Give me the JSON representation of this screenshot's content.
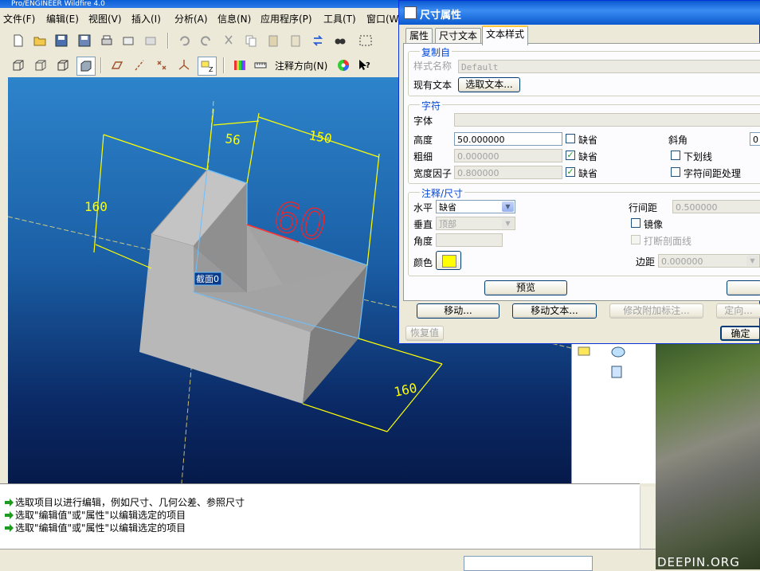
{
  "app": {
    "title": "Pro/ENGINEER Wildfire 4.0",
    "menu": [
      "文件(F)",
      "编辑(E)",
      "视图(V)",
      "插入(I)",
      "分析(A)",
      "信息(N)",
      "应用程序(P)",
      "工具(T)",
      "窗口(W)"
    ],
    "toolbar_annotation_dir": "注释方向(N)"
  },
  "model": {
    "dim_56": "56",
    "dim_150": "150",
    "dim_160_left": "160",
    "dim_160_bottom": "160",
    "dim_60": "60",
    "section_label": "截面0"
  },
  "messages": [
    "选取项目以进行编辑，例如尺寸、几何公差、参照尺寸",
    "选取\"编辑值\"或\"属性\"以编辑选定的项目",
    "选取\"编辑值\"或\"属性\"以编辑选定的项目"
  ],
  "dialog": {
    "title": "尺寸属性",
    "tabs": [
      "属性",
      "尺寸文本",
      "文本样式"
    ],
    "copy_group": {
      "title": "复制自",
      "style_name_label": "样式名称",
      "style_name_value": "Default",
      "existing_text_label": "现有文本",
      "select_text_button": "选取文本..."
    },
    "char_group": {
      "title": "字符",
      "font_label": "字体",
      "font_value": "",
      "height_label": "高度",
      "height_value": "50.000000",
      "default_label": "缺省",
      "slant_label": "斜角",
      "slant_value": "0",
      "thickness_label": "粗细",
      "thickness_value": "0.000000",
      "underline_label": "下划线",
      "width_factor_label": "宽度因子",
      "width_factor_value": "0.800000",
      "kerning_label": "字符间距处理"
    },
    "note_group": {
      "title": "注释/尺寸",
      "horizontal_label": "水平",
      "horizontal_value": "缺省",
      "vertical_label": "垂直",
      "vertical_value": "顶部",
      "angle_label": "角度",
      "color_label": "颜色",
      "color_value": "#ffff00",
      "line_spacing_label": "行间距",
      "line_spacing_value": "0.500000",
      "mirror_label": "镜像",
      "break_hatch_label": "打断剖面线",
      "margin_label": "边距",
      "margin_value": "0.000000"
    },
    "preview_button": "预览",
    "move_button": "移动...",
    "move_text_button": "移动文本...",
    "modify_leader_button": "修改附加标注...",
    "orient_button": "定向...",
    "restore_button": "恢复值",
    "ok_button": "确定"
  },
  "watermark": "DEEPIN.ORG"
}
